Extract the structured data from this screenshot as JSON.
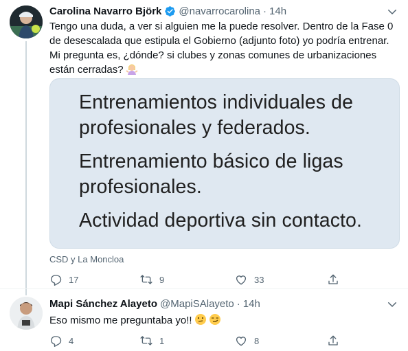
{
  "tweet1": {
    "author_name": "Carolina Navarro Björk",
    "handle": "@navarrocarolina",
    "separator": "·",
    "time": "14h",
    "text_lines": [
      "Tengo una duda, a ver si alguien me la puede resolver. Dentro de la Fase 0",
      "de desescalada que estipula el Gobierno (adjunto foto) yo podría entrenar.",
      "Mi pregunta es, ¿dónde? si clubes y zonas comunes de urbanizaciones",
      "están cerradas?"
    ],
    "text_emoji_icon": "woman-shrugging-emoji",
    "media_lines": [
      "Entrenamientos individuales de",
      "profesionales y federados.",
      "Entrenamiento básico de ligas",
      "profesionales.",
      "Actividad deportiva sin contacto."
    ],
    "media_caption": "CSD y La Moncloa",
    "replies": "17",
    "retweets": "9",
    "likes": "33"
  },
  "tweet2": {
    "author_name": "Mapi Sánchez Alayeto",
    "handle": "@MapiSAlayeto",
    "separator": "·",
    "time": "14h",
    "text": "Eso mismo me preguntaba yo!!",
    "text_emojis": [
      "thinking-face-emoji",
      "smirking-face-emoji"
    ],
    "replies": "4",
    "retweets": "1",
    "likes": "8"
  },
  "colors": {
    "verified_blue": "#1d9bf0",
    "secondary_text": "#536471",
    "media_background": "#dfe8f1"
  }
}
